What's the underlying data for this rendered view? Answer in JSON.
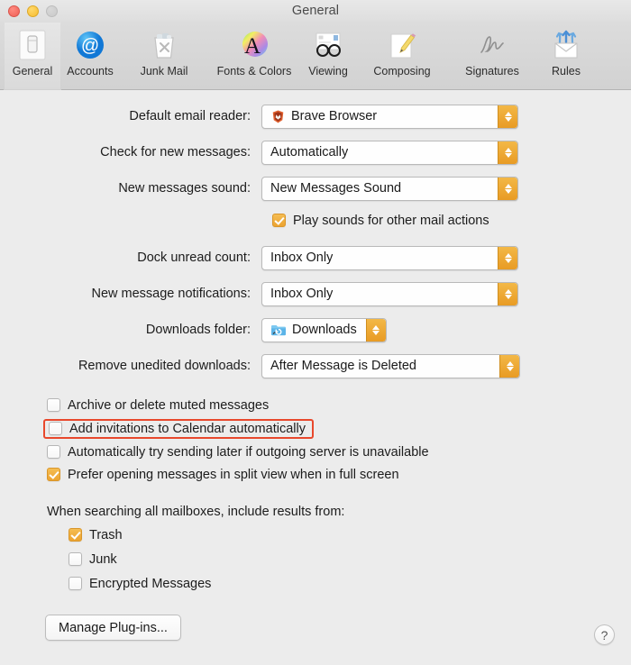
{
  "window": {
    "title": "General",
    "traffic_lights": [
      {
        "name": "close",
        "color": "#ef5f56"
      },
      {
        "name": "minimize",
        "color": "#f6bd30"
      },
      {
        "name": "zoom",
        "color": "#c9c9c9"
      }
    ]
  },
  "toolbar": {
    "selected": "General",
    "items": [
      {
        "label": "General",
        "icon": "general-icon"
      },
      {
        "label": "Accounts",
        "icon": "accounts-at-icon"
      },
      {
        "label": "Junk Mail",
        "icon": "junk-mail-trash-icon"
      },
      {
        "label": "Fonts & Colors",
        "icon": "fonts-colors-icon"
      },
      {
        "label": "Viewing",
        "icon": "viewing-glasses-icon"
      },
      {
        "label": "Composing",
        "icon": "composing-pencil-icon"
      },
      {
        "label": "Signatures",
        "icon": "signatures-icon"
      },
      {
        "label": "Rules",
        "icon": "rules-envelope-icon"
      }
    ]
  },
  "form": {
    "rows": [
      {
        "label": "Default email reader:",
        "value": "Brave Browser",
        "icon": "brave-lion-icon"
      },
      {
        "label": "Check for new messages:",
        "value": "Automatically",
        "icon": null
      },
      {
        "label": "New messages sound:",
        "value": "New Messages Sound",
        "icon": null
      },
      {
        "label": "Dock unread count:",
        "value": "Inbox Only",
        "icon": null
      },
      {
        "label": "New message notifications:",
        "value": "Inbox Only",
        "icon": null
      },
      {
        "label": "Downloads folder:",
        "value": "Downloads",
        "icon": "blue-folder-icon"
      },
      {
        "label": "Remove unedited downloads:",
        "value": "After Message is Deleted",
        "icon": null
      }
    ],
    "play_sounds": {
      "label": "Play sounds for other mail actions",
      "checked": true
    }
  },
  "options": [
    {
      "label": "Archive or delete muted messages",
      "checked": false,
      "highlighted": false
    },
    {
      "label": "Add invitations to Calendar automatically",
      "checked": false,
      "highlighted": true
    },
    {
      "label": "Automatically try sending later if outgoing server is unavailable",
      "checked": false,
      "highlighted": false
    },
    {
      "label": "Prefer opening messages in split view when in full screen",
      "checked": true,
      "highlighted": false
    }
  ],
  "search_section": {
    "title": "When searching all mailboxes, include results from:",
    "items": [
      {
        "label": "Trash",
        "checked": true
      },
      {
        "label": "Junk",
        "checked": false
      },
      {
        "label": "Encrypted Messages",
        "checked": false
      }
    ]
  },
  "footer": {
    "manage_plugins_label": "Manage Plug-ins...",
    "help_label": "?"
  },
  "colors": {
    "accent_amber": "#eca330",
    "highlight_red": "#e8482c",
    "window_bg": "#ececec"
  }
}
